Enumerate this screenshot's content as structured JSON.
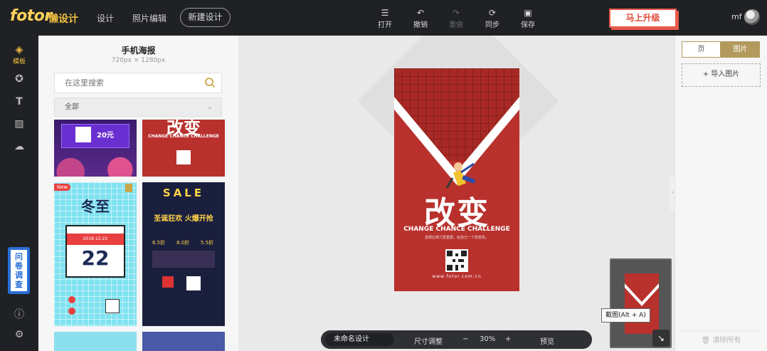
{
  "header": {
    "logo": "fotor",
    "logo_sub": "懒设计",
    "nav": [
      "设计",
      "照片编辑"
    ],
    "new_design": "新建设计",
    "tools": [
      {
        "label": "打开",
        "icon": "menu-icon",
        "enabled": true
      },
      {
        "label": "撤销",
        "icon": "undo-icon",
        "enabled": true
      },
      {
        "label": "重做",
        "icon": "redo-icon",
        "enabled": false
      },
      {
        "label": "同步",
        "icon": "sync-icon",
        "enabled": true
      },
      {
        "label": "保存",
        "icon": "save-icon",
        "enabled": true
      }
    ],
    "upgrade": "马上升级",
    "user": "mf"
  },
  "rail": {
    "active_label": "模板",
    "survey": "问卷调查",
    "icons": [
      "templates-icon",
      "star-icon",
      "text-icon",
      "background-icon",
      "upload-icon",
      "info-icon",
      "settings-icon"
    ]
  },
  "panel": {
    "title": "手机海报",
    "size": "720px × 1280px",
    "search_placeholder": "在这里搜索",
    "filter": "全部",
    "templates": {
      "t1_price": "20元",
      "t2_title": "改变",
      "t2_slogan": "CHANGE CHANCE CHALLENGE",
      "t3_badge": "New",
      "t3_title": "冬至",
      "t3_date": "2018-12-22",
      "t3_day": "22",
      "t4_title": "SALE",
      "t4_head": "圣诞狂欢 火爆开抢",
      "t4_prices": [
        "6.5折",
        "8.0折",
        "5.5折"
      ]
    }
  },
  "poster": {
    "title": "改变",
    "slogan": "CHANGE CHANCE CHALLENGE",
    "sub": "选择比努力更重要，给自己一个改变机。",
    "url": "www.fotor.com.cn"
  },
  "bottom_bar": {
    "doc_name": "未命名设计",
    "resize": "尺寸调整",
    "minus": "−",
    "zoom": "30%",
    "plus": "+",
    "preview": "预览"
  },
  "minimap": {
    "tooltip": "截图(Alt + A)"
  },
  "right_panel": {
    "tab_page": "页",
    "tab_image": "图片",
    "import": "导入图片",
    "clear_all": "清除所有"
  },
  "colors": {
    "topbar": "#1f2124",
    "accent_gold": "#b39a5c",
    "poster_red": "#b8312d",
    "upgrade_red": "#e85a4a"
  }
}
